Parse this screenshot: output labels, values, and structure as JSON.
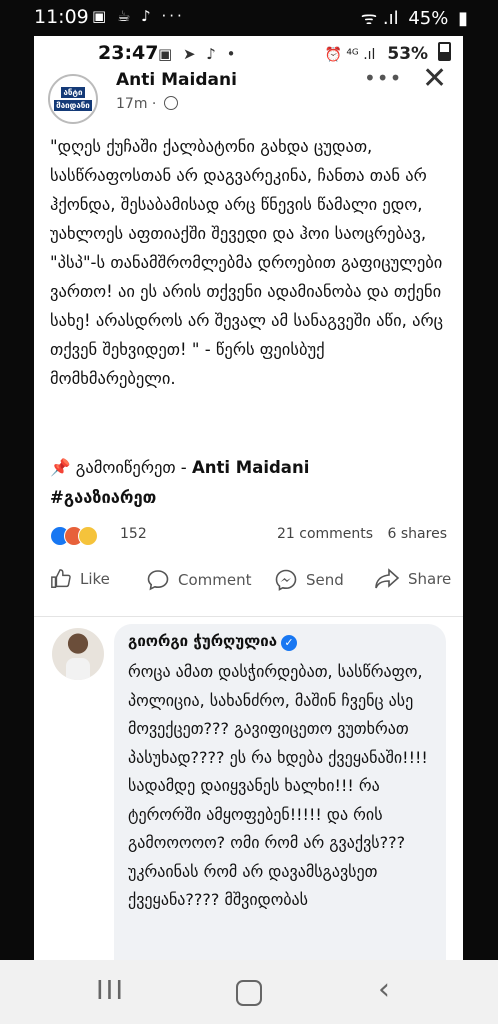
{
  "os_status": {
    "time": "11:09",
    "icons": "▣ ☕ ♪ ···",
    "signal": "ᯤ .ıl",
    "battery": "45%",
    "battery_icon": "▮"
  },
  "inner_status": {
    "time": "23:47",
    "icons": "▣ ➤ ♪ •",
    "right_icons": "⏰ ⁴ᴳ .ıl",
    "battery": "53%"
  },
  "post": {
    "page_logo_line1": "ანტი",
    "page_logo_line2": "მაიდანი",
    "page_name": "Anti Maidani",
    "time": "17m ·",
    "more": "•••",
    "close": "✕",
    "body": "\"დღეს ქუჩაში ქალბატონი გახდა ცუდათ, სასწრაფოსთან არ დაგვარეკინა, ჩანთა თან არ ჰქონდა, შესაბამისად არც წნევის წამალი ედო, უახლოეს აფთიაქში შევედი და ჰოი საოცრებავ, \"პსპ\"-ს თანამშრომლებმა დროებით გაფიცულები ვართო! აი ეს არის თქვენი ადამიანობა და თქენი სახე! არასდროს არ შევალ ამ სანაგვეში აწი, არც თქვენ შეხვიდეთ! \" - წერს ფეისბუქ მომხმარებელი.",
    "share_pin": "📌",
    "share_text": "გამოიწერეთ - ",
    "share_name": "Anti Maidani",
    "hashtag": "#გააზიარეთ",
    "reaction_count": "152",
    "comments": "21 comments",
    "shares": "6 shares"
  },
  "actions": {
    "like": "Like",
    "comment": "Comment",
    "send": "Send",
    "share": "Share"
  },
  "comment": {
    "author": "გიორგი ჭურღულია",
    "verified_mark": "✓",
    "text": "როცა ამათ დასჭირდებათ, სასწრაფო, პოლიცია, სახანძრო, მაშინ ჩვენც ასე მოვექცეთ??? გავიფიცეთო ვუთხრათ პასუხად???? ეს რა ხდება ქვეყანაში!!!! სადამდე დაიყვანეს ხალხი!!! რა ტერორში ამყოფებენ!!!!! და რის გამოოოოო? ომი რომ არ გვაქვს??? უკრაინას რომ არ დავამსგავსეთ ქვეყანა???? მშვიდობას"
  },
  "navbar": {
    "recent": "III",
    "back": "‹"
  }
}
